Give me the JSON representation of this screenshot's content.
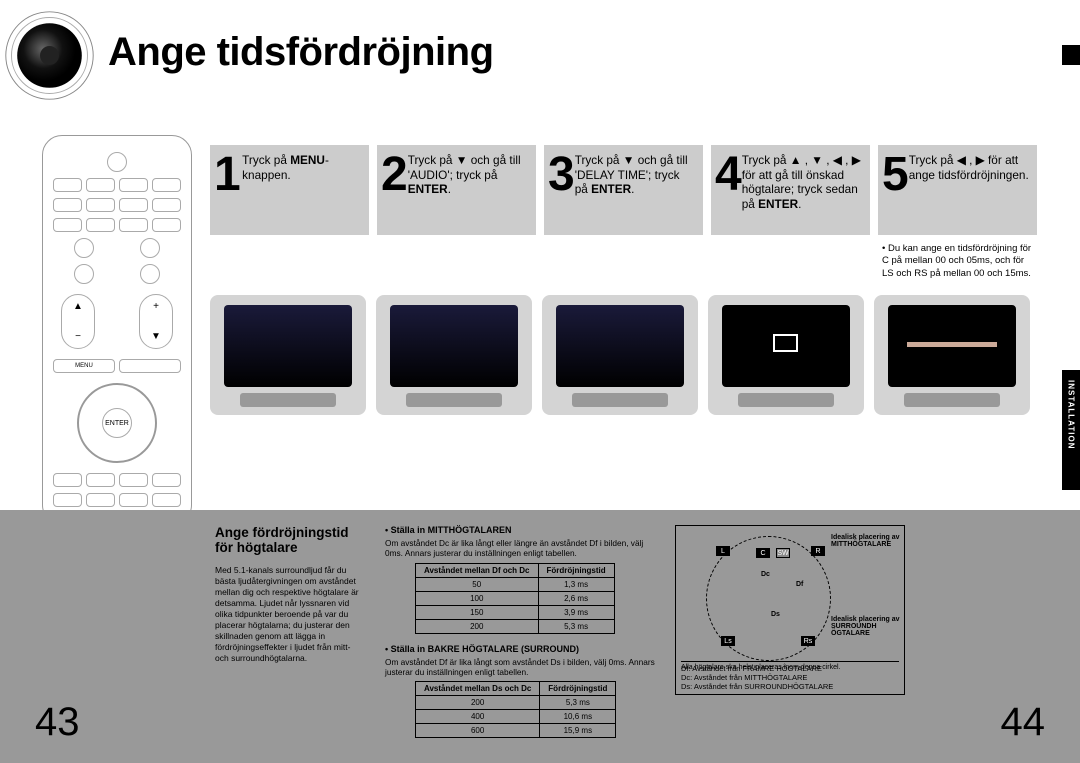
{
  "title": "Ange tidsfördröjning",
  "sideTab": "INSTALLATION",
  "steps": [
    {
      "num": "1",
      "html": "Tryck på <b>MENU</b>-knappen."
    },
    {
      "num": "2",
      "html": "Tryck på ▼ och gå till 'AUDIO'; tryck på <b>ENTER</b>."
    },
    {
      "num": "3",
      "html": "Tryck på ▼ och gå till 'DELAY TIME'; tryck på <b>ENTER</b>."
    },
    {
      "num": "4",
      "html": "Tryck på ▲ , ▼ , ◀ , ▶ för att gå till önskad högtalare; tryck sedan på <b>ENTER</b>."
    },
    {
      "num": "5",
      "html": "Tryck på ◀ , ▶ för att ange tidsfördröjningen."
    }
  ],
  "step5Note": "Du kan ange en tidsfördröjning för C på mellan 00 och 05ms, och för LS och RS på mellan 00 och 15ms.",
  "remote": {
    "enter": "ENTER",
    "menu": "MENU"
  },
  "bottom": {
    "subtitle": "Ange fördröjningstid för högtalare",
    "leftBody": "Med 5.1-kanals surroundljud får du bästa ljudåtergivningen om avståndet mellan dig och respektive högtalare är detsamma. Ljudet når lyssnaren vid olika tidpunkter beroende på var du placerar högtalarna; du justerar den skillnaden genom att lägga in fördröjningseffekter i ljudet från mitt- och surroundhögtalarna.",
    "center": {
      "head": "Ställa in MITTHÖGTALAREN",
      "text": "Om avståndet Dc är lika långt eller längre än avståndet Df i bilden, välj 0ms. Annars justerar du inställningen enligt tabellen.",
      "tableHead": [
        "Avståndet mellan Df och Dc",
        "Fördröjningstid"
      ],
      "rows": [
        [
          "50",
          "1,3 ms"
        ],
        [
          "100",
          "2,6 ms"
        ],
        [
          "150",
          "3,9 ms"
        ],
        [
          "200",
          "5,3 ms"
        ]
      ]
    },
    "surround": {
      "head": "Ställa in BAKRE HÖGTALARE (SURROUND)",
      "text": "Om avståndet Df är lika långt som avståndet Ds i bilden, välj 0ms. Annars justerar du inställningen enligt tabellen.",
      "tableHead": [
        "Avståndet mellan Ds och Dc",
        "Fördröjningstid"
      ],
      "rows": [
        [
          "200",
          "5,3 ms"
        ],
        [
          "400",
          "10,6 ms"
        ],
        [
          "600",
          "15,9 ms"
        ]
      ]
    },
    "diagram": {
      "idealCenter": "Idealisk placering av MITTHÖGTALARE",
      "idealSurround": "Idealisk placering av SURROUNDH ÖGTALARE",
      "allNote": "Alla högtalare ska helst placeras inom denna cirkel.",
      "legend": "Df: Avståndet från FRÄMRE HÖGTALARE\nDc: Avståndet från MITTHÖGTALARE\nDs: Avståndet från SURROUNDHÖGTALARE",
      "labels": {
        "L": "L",
        "C": "C",
        "R": "R",
        "SW": "SW",
        "Ls": "Ls",
        "Rs": "Rs",
        "Dc": "Dc",
        "Df": "Df",
        "Ds": "Ds"
      }
    }
  },
  "pageLeft": "43",
  "pageRight": "44"
}
